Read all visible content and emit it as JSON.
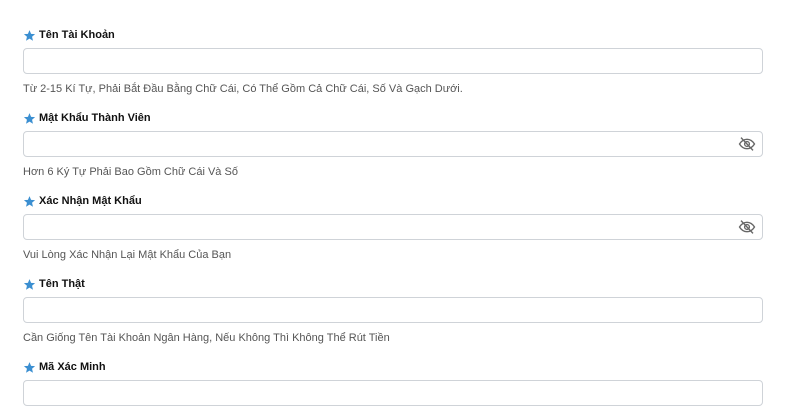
{
  "colors": {
    "star": "#3b8fd1",
    "input_border": "#cfd3d8",
    "hint_text": "#555555",
    "eye_icon": "#666666"
  },
  "fields": [
    {
      "label": "Tên Tài Khoản",
      "value": "",
      "placeholder": "",
      "hint": "Từ 2-15 Kí Tự, Phải Bắt Đầu Bằng Chữ Cái, Có Thể Gồm Cả Chữ Cái, Số Và Gạch Dưới.",
      "icon": "star-icon"
    },
    {
      "label": "Mật Khẩu Thành Viên",
      "value": "",
      "placeholder": "",
      "hint": "Hơn 6 Ký Tự Phải Bao Gồm Chữ Cái Và Số",
      "icon": "star-icon",
      "trailing_icon": "eye-slash-icon"
    },
    {
      "label": "Xác Nhận Mật Khẩu",
      "value": "",
      "placeholder": "",
      "hint": "Vui Lòng Xác Nhận Lại Mật Khẩu Của Bạn",
      "icon": "star-icon",
      "trailing_icon": "eye-slash-icon"
    },
    {
      "label": "Tên Thật",
      "value": "",
      "placeholder": "",
      "hint": "Cần Giống Tên Tài Khoản Ngân Hàng, Nếu Không Thì Không Thể Rút Tiền",
      "icon": "star-icon"
    },
    {
      "label": "Mã Xác Minh",
      "value": "",
      "placeholder": "",
      "icon": "star-icon"
    }
  ]
}
